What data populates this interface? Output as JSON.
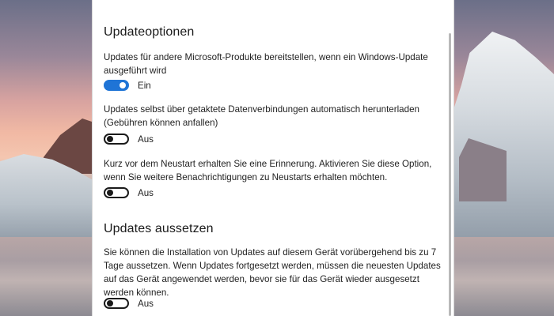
{
  "sections": [
    {
      "title": "Updateoptionen",
      "options": [
        {
          "description": "Updates für andere Microsoft-Produkte bereitstellen, wenn ein Windows-Update ausgeführt wird",
          "state": "Ein",
          "enabled": true
        },
        {
          "description": "Updates selbst über getaktete Datenverbindungen automatisch herunterladen (Gebühren können anfallen)",
          "state": "Aus",
          "enabled": false
        },
        {
          "description": "Kurz vor dem Neustart erhalten Sie eine Erinnerung. Aktivieren Sie diese Option, wenn Sie weitere Benachrichtigungen zu Neustarts erhalten möchten.",
          "state": "Aus",
          "enabled": false
        }
      ]
    },
    {
      "title": "Updates aussetzen",
      "options": [
        {
          "description": "Sie können die Installation von Updates auf diesem Gerät vorübergehend bis zu 7 Tage aussetzen. Wenn Updates fortgesetzt werden, müssen die neuesten Updates auf das Gerät angewendet werden, bevor sie für das Gerät wieder ausgesetzt werden können.",
          "state": "Aus",
          "enabled": false
        }
      ]
    }
  ],
  "colors": {
    "toggle_on": "#1f74d6",
    "toggle_off_border": "#1a1a1a",
    "panel_background": "#ffffff"
  }
}
